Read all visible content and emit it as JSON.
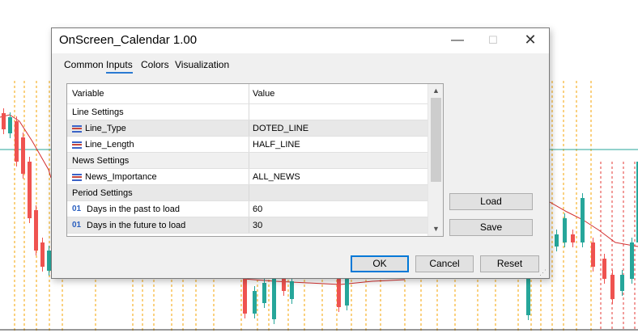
{
  "window": {
    "title": "OnScreen_Calendar 1.00",
    "minimize_glyph": "—",
    "maximize_glyph": "☐",
    "close_glyph": "✕"
  },
  "tabs": [
    {
      "label": "Common",
      "active": false
    },
    {
      "label": "Inputs",
      "active": true
    },
    {
      "label": "Colors",
      "active": false
    },
    {
      "label": "Visualization",
      "active": false
    }
  ],
  "grid": {
    "headers": {
      "variable": "Variable",
      "value": "Value"
    },
    "rows": [
      {
        "type": "section",
        "variable": "Line Settings",
        "value": ""
      },
      {
        "type": "param",
        "icon": "enum-list-icon",
        "variable": "Line_Type",
        "value": "DOTED_LINE"
      },
      {
        "type": "param",
        "icon": "enum-list-icon",
        "variable": "Line_Length",
        "value": "HALF_LINE"
      },
      {
        "type": "section",
        "variable": "News Settings",
        "value": ""
      },
      {
        "type": "param",
        "icon": "enum-list-icon",
        "variable": "News_Importance",
        "value": "ALL_NEWS"
      },
      {
        "type": "section",
        "variable": "Period Settings",
        "value": ""
      },
      {
        "type": "param",
        "icon": "integer-icon",
        "icon_text": "01",
        "variable": "Days in the past to load",
        "value": "60"
      },
      {
        "type": "param",
        "icon": "integer-icon",
        "icon_text": "01",
        "variable": "Days in the future to load",
        "value": "30"
      }
    ],
    "scroll_up_glyph": "▲",
    "scroll_down_glyph": "▼"
  },
  "buttons": {
    "load": "Load",
    "save": "Save",
    "ok": "OK",
    "cancel": "Cancel",
    "reset": "Reset"
  },
  "colors": {
    "bull": "#26a69a",
    "bear": "#ef5350",
    "ma_line": "#d32f2f",
    "level_line": "#26a69a",
    "past_event_line": "#f4a300",
    "future_event_line": "#e53935",
    "accent": "#0078d7"
  }
}
